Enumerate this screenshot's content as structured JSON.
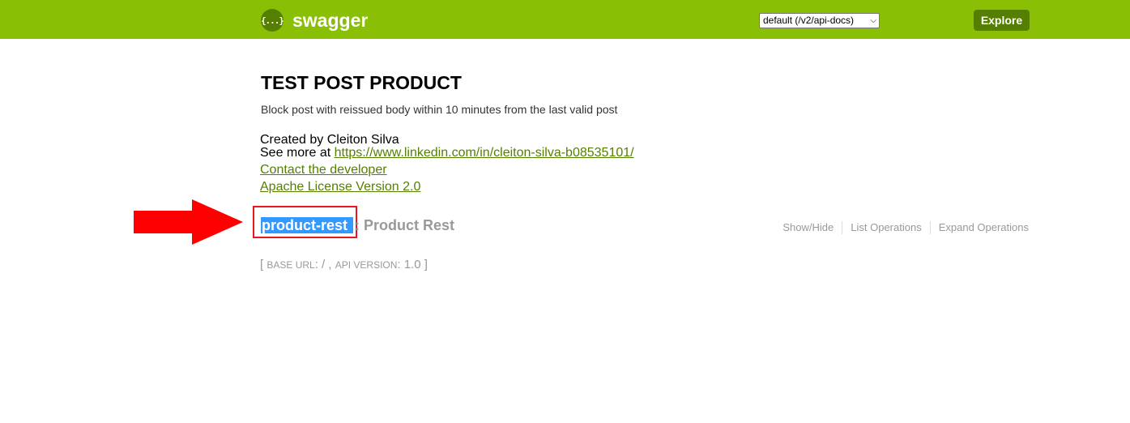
{
  "header": {
    "logo_glyph": "{...}",
    "logo_text": "swagger",
    "spec_selected": "default (/v2/api-docs)",
    "explore_label": "Explore",
    "colors": {
      "bar": "#89bf04",
      "button": "#547f00"
    }
  },
  "info": {
    "title": "TEST POST PRODUCT",
    "description": "Block post with reissued body within 10 minutes from the last valid post",
    "created_by": "Created by Cleiton Silva",
    "see_more_prefix": "See more at ",
    "see_more_url": "https://www.linkedin.com/in/cleiton-silva-b08535101/",
    "contact_label": "Contact the developer",
    "license_label": "Apache License Version 2.0"
  },
  "resource": {
    "name": "product-rest",
    "separator": ":",
    "description": "Product Rest",
    "ops": [
      "Show/Hide",
      "List Operations",
      "Expand Operations"
    ]
  },
  "footer": {
    "open_bracket": "[",
    "base_url_label": "base url",
    "base_url_sep": ":",
    "base_url_value": "/",
    "comma": ",",
    "api_version_label": "api version",
    "api_version_sep": ":",
    "api_version_value": "1.0",
    "close_bracket": "]"
  },
  "annotation": {
    "arrow_color": "#ff0000",
    "highlight_box_color": "#e8161f"
  }
}
